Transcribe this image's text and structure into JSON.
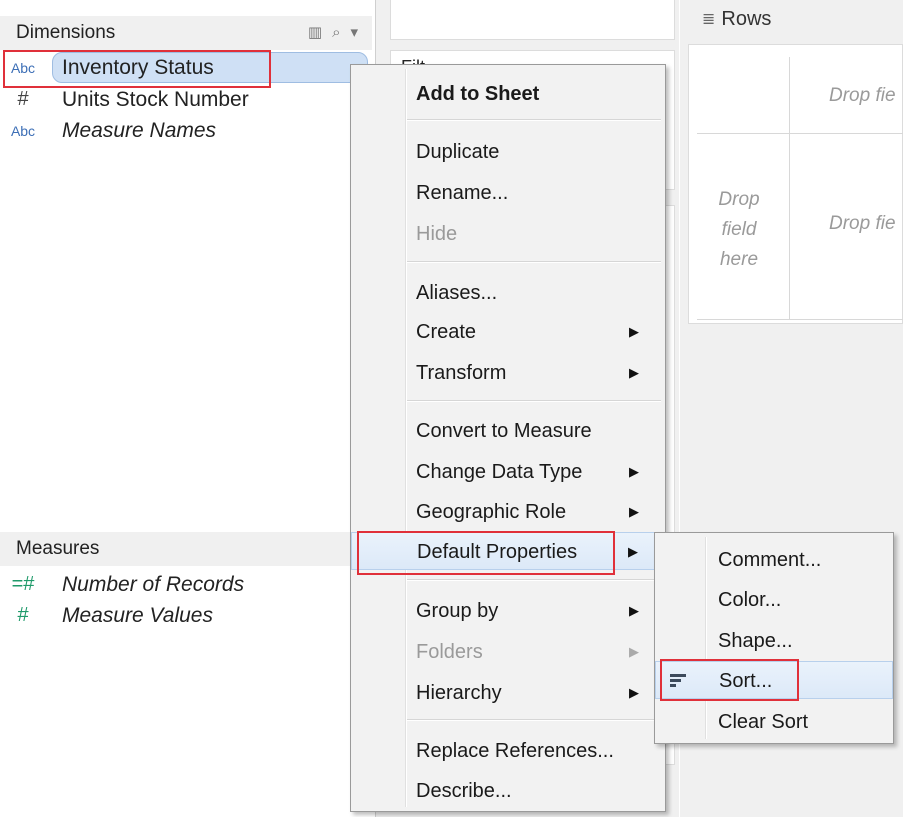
{
  "data_pane": {
    "dimensions_header": "Dimensions",
    "dimension_fields": [
      {
        "type_icon": "Abc",
        "label": "Inventory Status"
      },
      {
        "type_icon": "#",
        "label": "Units Stock Number"
      },
      {
        "type_icon": "Abc",
        "label": "Measure Names"
      }
    ],
    "measures_header": "Measures",
    "measure_fields": [
      {
        "type_icon": "=#",
        "label": "Number of Records"
      },
      {
        "type_icon": "#",
        "label": "Measure Values"
      }
    ]
  },
  "shelves": {
    "filters_label": "Filt",
    "rows_label": "Rows"
  },
  "canvas": {
    "drop_field_here": "Drop field here",
    "drop_field_top": "Drop fie",
    "drop_field_right": "Drop fie"
  },
  "context_menu": {
    "items": [
      {
        "label": "Add to Sheet"
      },
      {
        "label": "Duplicate"
      },
      {
        "label": "Rename..."
      },
      {
        "label": "Hide"
      },
      {
        "label": "Aliases..."
      },
      {
        "label": "Create"
      },
      {
        "label": "Transform"
      },
      {
        "label": "Convert to Measure"
      },
      {
        "label": "Change Data Type"
      },
      {
        "label": "Geographic Role"
      },
      {
        "label": "Default Properties"
      },
      {
        "label": "Group by"
      },
      {
        "label": "Folders"
      },
      {
        "label": "Hierarchy"
      },
      {
        "label": "Replace References..."
      },
      {
        "label": "Describe..."
      }
    ]
  },
  "submenu": {
    "items": [
      {
        "label": "Comment..."
      },
      {
        "label": "Color..."
      },
      {
        "label": "Shape..."
      },
      {
        "label": "Sort..."
      },
      {
        "label": "Clear Sort"
      }
    ]
  },
  "colors": {
    "highlight_red": "#e0303a",
    "selection_blue": "#cfe0f5",
    "string_icon_blue": "#3d6fb6",
    "measure_green": "#1f9a6a"
  },
  "icons": {
    "submenu_arrow": "▶",
    "rows_icon": "≣",
    "search_icon": "⌕",
    "dropdown_icon": "▾",
    "columns_view_icon": "▥"
  }
}
